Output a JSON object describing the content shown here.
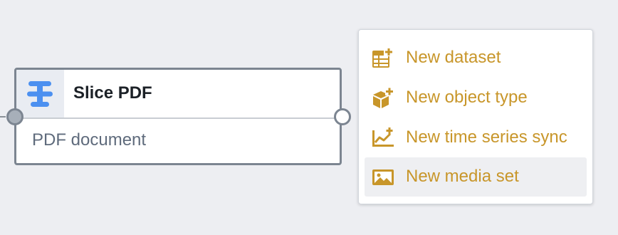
{
  "node": {
    "title": "Slice PDF",
    "subtitle": "PDF document",
    "icon": "slice-transform-icon"
  },
  "menu": {
    "items": [
      {
        "label": "New dataset",
        "icon": "dataset-add-icon",
        "highlighted": false
      },
      {
        "label": "New object type",
        "icon": "cube-add-icon",
        "highlighted": false
      },
      {
        "label": "New time series sync",
        "icon": "timeseries-add-icon",
        "highlighted": false
      },
      {
        "label": "New media set",
        "icon": "media-image-icon",
        "highlighted": true
      }
    ]
  },
  "colors": {
    "canvas": "#edeef2",
    "node_border": "#7c8591",
    "node_icon": "#4c90f0",
    "menu_accent": "#c8962a",
    "menu_highlight": "#eeeff2"
  }
}
